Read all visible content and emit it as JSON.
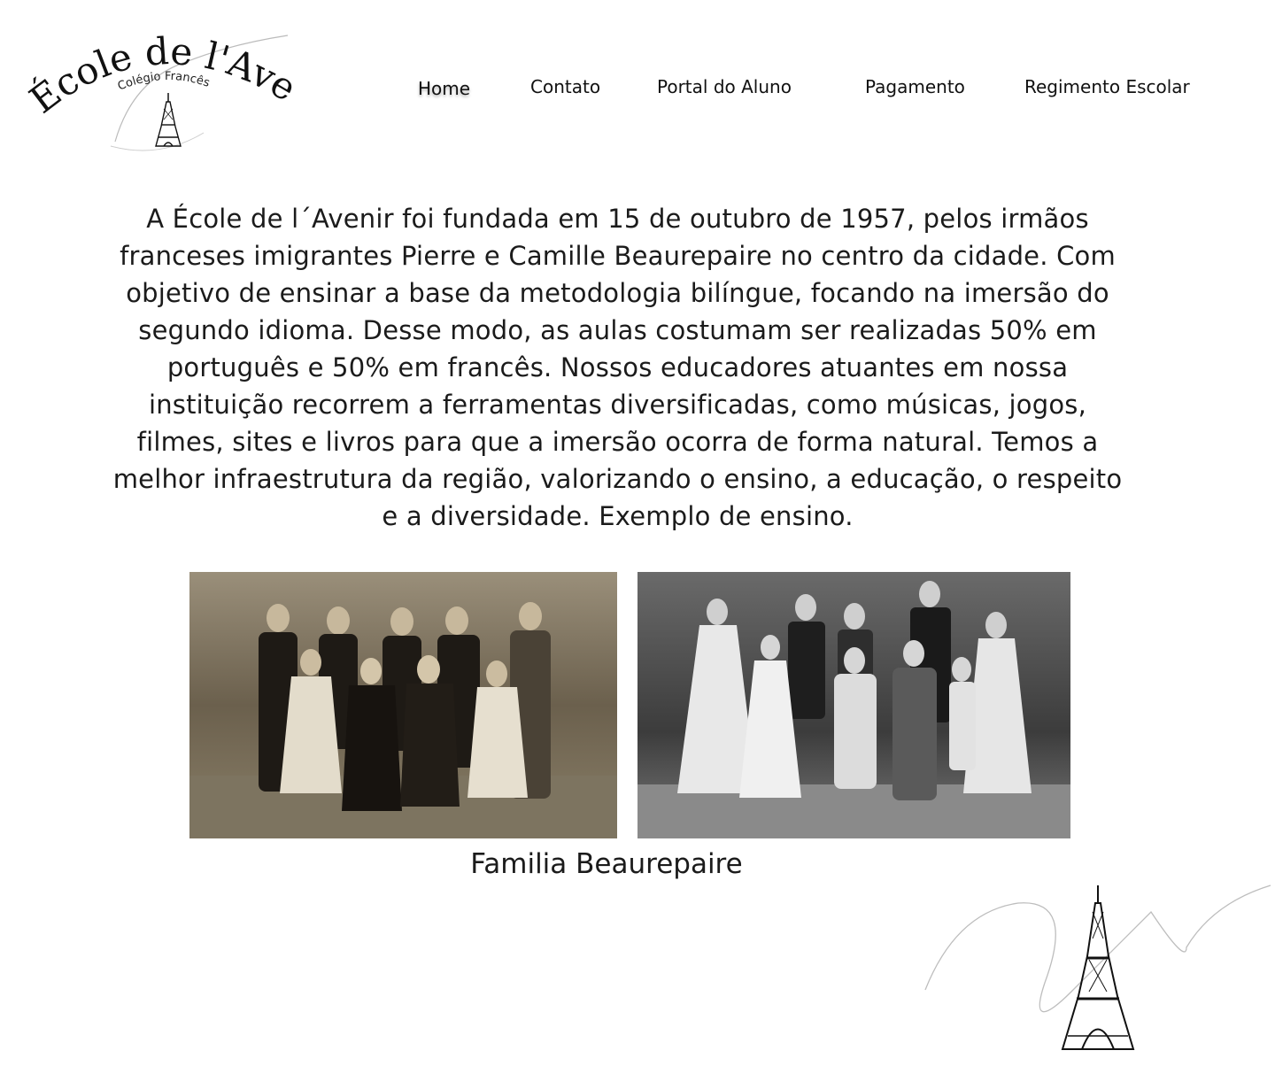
{
  "brand": {
    "name": "École de l'Avenir",
    "tagline": "Colégio Francês"
  },
  "nav": {
    "items": [
      {
        "label": "Home",
        "active": true
      },
      {
        "label": "Contato"
      },
      {
        "label": "Portal do Aluno"
      },
      {
        "label": "Pagamento"
      },
      {
        "label": "Regimento Escolar"
      }
    ]
  },
  "main": {
    "intro": "A École de l´Avenir foi fundada em 15 de outubro de 1957, pelos irmãos franceses imigrantes Pierre e Camille Beaurepaire no centro da cidade. Com objetivo de ensinar a base da metodologia bilíngue, focando na imersão do segundo idioma. Desse modo, as aulas costumam ser realizadas 50% em português e 50% em francês. Nossos educadores atuantes em nossa instituição recorrem a ferramentas diversificadas, como músicas, jogos, filmes, sites e livros para que a imersão ocorra de forma natural. Temos a melhor infraestrutura da região, valorizando o ensino, a educação, o respeito e a diversidade. Exemplo de ensino.",
    "caption": "Familia Beaurepaire"
  },
  "icons": {
    "logo": "eiffel-tower-icon",
    "decoration": "eiffel-tower-icon"
  }
}
